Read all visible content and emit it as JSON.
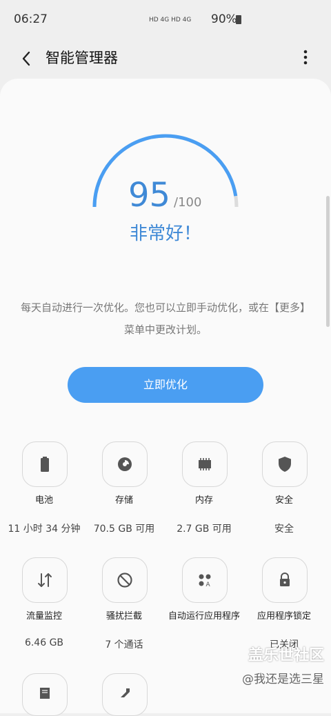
{
  "status": {
    "time": "06:27",
    "indicators": "HD 4G HD 4G",
    "battery": "90%"
  },
  "header": {
    "title": "智能管理器",
    "back_icon": "back-arrow-icon",
    "more_icon": "more-vert-icon"
  },
  "score": {
    "value": "95",
    "max": "/100",
    "rating": "非常好！",
    "percent": 95
  },
  "description": "每天自动进行一次优化。您也可以立即手动优化，或在【更多】菜单中更改计划。",
  "optimize_button": "立即优化",
  "tiles": [
    {
      "label": "电池",
      "value": "11 小时 34 分钟",
      "icon": "battery-icon"
    },
    {
      "label": "存储",
      "value": "70.5 GB 可用",
      "icon": "storage-pie-icon"
    },
    {
      "label": "内存",
      "value": "2.7 GB 可用",
      "icon": "memory-chip-icon"
    },
    {
      "label": "安全",
      "value": "安全",
      "icon": "shield-icon"
    },
    {
      "label": "流量监控",
      "value": "6.46 GB",
      "icon": "data-arrows-icon"
    },
    {
      "label": "骚扰拦截",
      "value": "7 个通话",
      "icon": "block-icon"
    },
    {
      "label": "自动运行应用程序",
      "value": "",
      "icon": "auto-run-apps-icon"
    },
    {
      "label": "应用程序锁定",
      "value": "已关闭",
      "icon": "lock-icon"
    }
  ],
  "watermark": {
    "line1": "盖乐世社区",
    "line2": "@我还是选三星"
  },
  "colors": {
    "accent": "#4a9ef2",
    "score_text": "#3f89d6",
    "background": "#efefef",
    "card": "#fafafa"
  }
}
